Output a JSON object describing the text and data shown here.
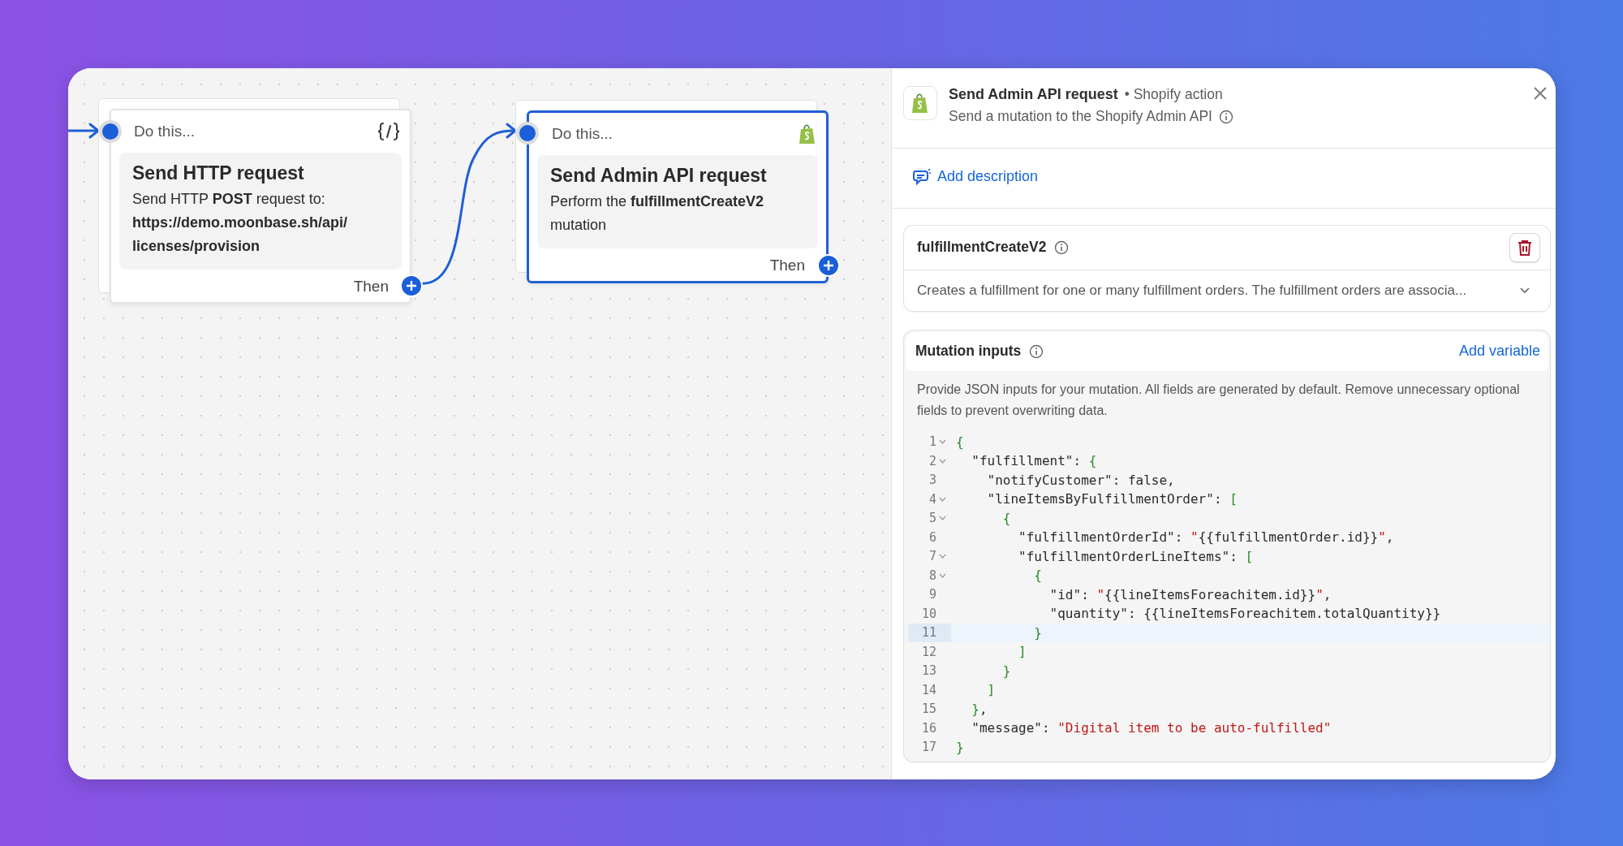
{
  "canvas": {
    "nodes": [
      {
        "header": "Do this...",
        "kind": "http",
        "title": "Send HTTP request",
        "description": [
          "Send HTTP **POST** request to:",
          "**https://demo.moonbase.sh/api/**",
          "**licenses/provision**"
        ],
        "then": "Then",
        "selected": false
      },
      {
        "header": "Do this...",
        "kind": "admin_api",
        "title": "Send Admin API request",
        "description": [
          "Perform the **fulfillmentCreateV2**",
          "mutation"
        ],
        "then": "Then",
        "selected": true
      }
    ]
  },
  "panel": {
    "title": "Send Admin API request",
    "category": "• Shopify action",
    "subtitle": "Send a mutation to the Shopify Admin API",
    "add_description": "Add description",
    "operation": {
      "name": "fulfillmentCreateV2",
      "description": "Creates a fulfillment for one or many fulfillment orders. The fulfillment orders are associa...",
      "expanded": false
    },
    "inputs": {
      "title": "Mutation inputs",
      "add_variable": "Add variable",
      "help": "Provide JSON inputs for your mutation. All fields are generated by default. Remove unnecessary optional fields to prevent overwriting data.",
      "lines": [
        {
          "number": "1",
          "foldable": true,
          "highlighted": false,
          "tokens": [
            {
              "kind": "brace",
              "text": "{"
            }
          ]
        },
        {
          "number": "2",
          "foldable": true,
          "highlighted": false,
          "tokens": [
            {
              "kind": "plain",
              "text": "  \"fulfillment\": "
            },
            {
              "kind": "brace",
              "text": "{"
            }
          ]
        },
        {
          "number": "3",
          "foldable": false,
          "highlighted": false,
          "tokens": [
            {
              "kind": "plain",
              "text": "    \"notifyCustomer\": false,"
            }
          ]
        },
        {
          "number": "4",
          "foldable": true,
          "highlighted": false,
          "tokens": [
            {
              "kind": "plain",
              "text": "    \"lineItemsByFulfillmentOrder\": "
            },
            {
              "kind": "brace",
              "text": "["
            }
          ]
        },
        {
          "number": "5",
          "foldable": true,
          "highlighted": false,
          "tokens": [
            {
              "kind": "brace",
              "text": "      {"
            }
          ]
        },
        {
          "number": "6",
          "foldable": false,
          "highlighted": false,
          "tokens": [
            {
              "kind": "plain",
              "text": "        \"fulfillmentOrderId\": "
            },
            {
              "kind": "string",
              "text": "\""
            },
            {
              "kind": "plain",
              "text": "{{fulfillmentOrder.id}}"
            },
            {
              "kind": "string",
              "text": "\""
            },
            {
              "kind": "plain",
              "text": ","
            }
          ]
        },
        {
          "number": "7",
          "foldable": true,
          "highlighted": false,
          "tokens": [
            {
              "kind": "plain",
              "text": "        \"fulfillmentOrderLineItems\": "
            },
            {
              "kind": "brace",
              "text": "["
            }
          ]
        },
        {
          "number": "8",
          "foldable": true,
          "highlighted": false,
          "tokens": [
            {
              "kind": "brace",
              "text": "          {"
            }
          ]
        },
        {
          "number": "9",
          "foldable": false,
          "highlighted": false,
          "tokens": [
            {
              "kind": "plain",
              "text": "            \"id\": "
            },
            {
              "kind": "string",
              "text": "\""
            },
            {
              "kind": "plain",
              "text": "{{lineItemsForeachitem.id}}"
            },
            {
              "kind": "string",
              "text": "\""
            },
            {
              "kind": "plain",
              "text": ","
            }
          ]
        },
        {
          "number": "10",
          "foldable": false,
          "highlighted": false,
          "tokens": [
            {
              "kind": "plain",
              "text": "            \"quantity\": {{lineItemsForeachitem.totalQuantity}}"
            }
          ]
        },
        {
          "number": "11",
          "foldable": false,
          "highlighted": true,
          "tokens": [
            {
              "kind": "brace",
              "text": "          }"
            }
          ]
        },
        {
          "number": "12",
          "foldable": false,
          "highlighted": false,
          "tokens": [
            {
              "kind": "brace",
              "text": "        ]"
            }
          ]
        },
        {
          "number": "13",
          "foldable": false,
          "highlighted": false,
          "tokens": [
            {
              "kind": "brace",
              "text": "      }"
            }
          ]
        },
        {
          "number": "14",
          "foldable": false,
          "highlighted": false,
          "tokens": [
            {
              "kind": "brace",
              "text": "    ]"
            }
          ]
        },
        {
          "number": "15",
          "foldable": false,
          "highlighted": false,
          "tokens": [
            {
              "kind": "brace",
              "text": "  }"
            },
            {
              "kind": "plain",
              "text": ","
            }
          ]
        },
        {
          "number": "16",
          "foldable": false,
          "highlighted": false,
          "tokens": [
            {
              "kind": "plain",
              "text": "  \"message\": "
            },
            {
              "kind": "string",
              "text": "\"Digital item to be auto-fulfilled\""
            }
          ]
        },
        {
          "number": "17",
          "foldable": false,
          "highlighted": false,
          "tokens": [
            {
              "kind": "brace",
              "text": "}"
            }
          ]
        }
      ]
    }
  }
}
